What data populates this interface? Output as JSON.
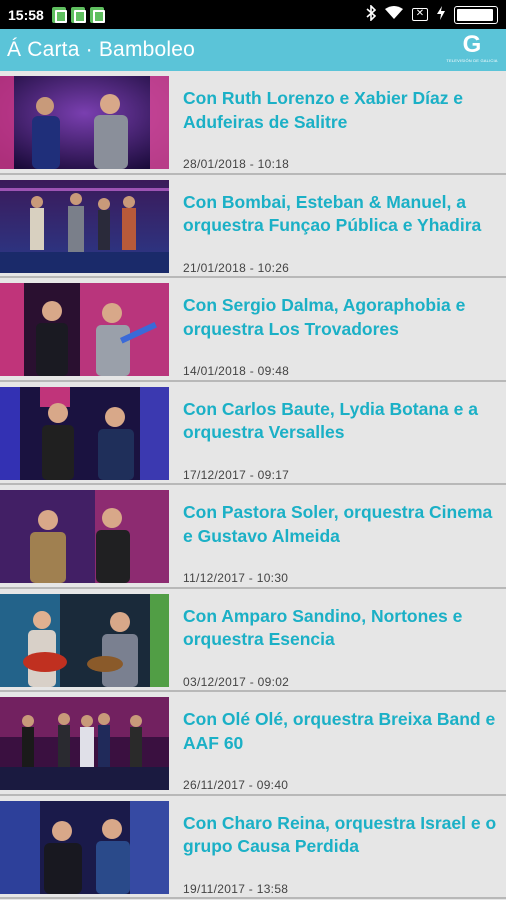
{
  "status_bar": {
    "time": "15:58",
    "icons": [
      "notification-icon",
      "notification-icon",
      "notification-icon",
      "bluetooth-icon",
      "wifi-icon",
      "sim-icon",
      "charging-icon",
      "battery-icon"
    ]
  },
  "app_bar": {
    "title": "Á Carta · Bamboleo",
    "logo_letter": "G",
    "logo_text": "TELEVISIÓN DE GALICIA"
  },
  "colors": {
    "accent": "#5bc4d8",
    "title_text": "#1bb0c6",
    "background": "#e6e6e6"
  },
  "episodes": [
    {
      "title": "Con Ruth Lorenzo e Xabier Díaz e Adufeiras de Salitre",
      "date": "28/01/2018 - 10:18"
    },
    {
      "title": "Con Bombai, Esteban & Manuel, a orquestra Funçao Pública e Yhadira",
      "date": "21/01/2018 - 10:26"
    },
    {
      "title": "Con Sergio Dalma, Agoraphobia e orquestra Los Trovadores",
      "date": "14/01/2018 - 09:48"
    },
    {
      "title": "Con Carlos Baute, Lydia Botana e a orquestra Versalles",
      "date": "17/12/2017 - 09:17"
    },
    {
      "title": "Con Pastora Soler, orquestra Cinema e Gustavo Almeida",
      "date": "11/12/2017 - 10:30"
    },
    {
      "title": "Con Amparo Sandino, Nortones e orquestra Esencia",
      "date": "03/12/2017 - 09:02"
    },
    {
      "title": "Con Olé Olé, orquestra Breixa Band e AAF 60",
      "date": "26/11/2017 - 09:40"
    },
    {
      "title": "Con Charo Reina, orquestra Israel e o grupo Causa Perdida",
      "date": "19/11/2017 - 13:58"
    }
  ]
}
